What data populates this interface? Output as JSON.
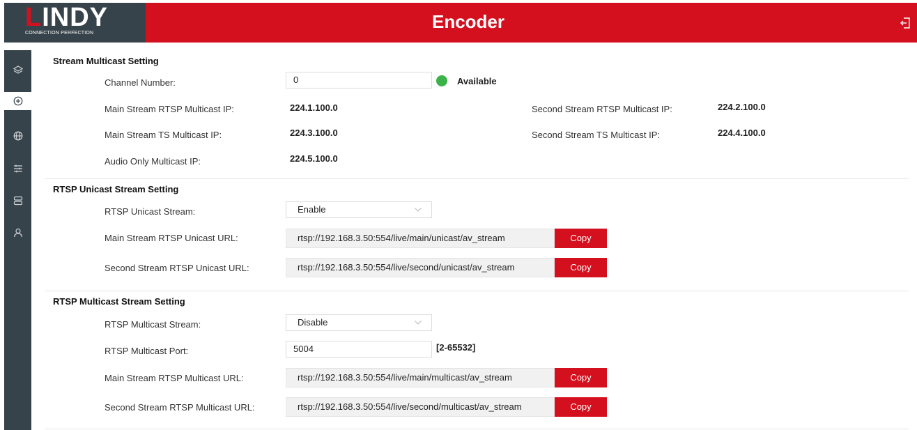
{
  "header": {
    "logo_text_rest": "INDY",
    "logo_subtitle": "CONNECTION PERFECTION",
    "title": "Encoder"
  },
  "sidebar": {
    "items": [
      {
        "icon": "layers-icon",
        "active": false
      },
      {
        "icon": "plus-circle-icon",
        "active": true
      },
      {
        "icon": "globe-icon",
        "active": false
      },
      {
        "icon": "sliders-icon",
        "active": false
      },
      {
        "icon": "server-icon",
        "active": false
      },
      {
        "icon": "user-icon",
        "active": false
      }
    ]
  },
  "stream_multicast": {
    "title": "Stream Multicast Setting",
    "channel_label": "Channel Number:",
    "channel_value": "0",
    "status_text": "Available",
    "status_color": "#3cb34a",
    "main_rtsp_label": "Main Stream RTSP Multicast IP:",
    "main_rtsp_value": "224.1.100.0",
    "second_rtsp_label": "Second Stream RTSP Multicast IP:",
    "second_rtsp_value": "224.2.100.0",
    "main_ts_label": "Main Stream TS Multicast IP:",
    "main_ts_value": "224.3.100.0",
    "second_ts_label": "Second Stream TS Multicast IP:",
    "second_ts_value": "224.4.100.0",
    "audio_label": "Audio Only Multicast IP:",
    "audio_value": "224.5.100.0"
  },
  "rtsp_unicast": {
    "title": "RTSP Unicast Stream Setting",
    "stream_label": "RTSP Unicast Stream:",
    "stream_value": "Enable",
    "main_url_label": "Main Stream RTSP Unicast URL:",
    "main_url_value": "rtsp://192.168.3.50:554/live/main/unicast/av_stream",
    "second_url_label": "Second Stream RTSP Unicast URL:",
    "second_url_value": "rtsp://192.168.3.50:554/live/second/unicast/av_stream",
    "copy_label": "Copy"
  },
  "rtsp_multicast": {
    "title": "RTSP Multicast Stream Setting",
    "stream_label": "RTSP Multicast Stream:",
    "stream_value": "Disable",
    "port_label": "RTSP Multicast Port:",
    "port_value": "5004",
    "port_range": "[2-65532]",
    "main_url_label": "Main Stream RTSP Multicast URL:",
    "main_url_value": "rtsp://192.168.3.50:554/live/main/multicast/av_stream",
    "second_url_label": "Second Stream RTSP Multicast URL:",
    "second_url_value": "rtsp://192.168.3.50:554/live/second/multicast/av_stream",
    "copy_label": "Copy"
  },
  "colors": {
    "brand_red": "#d5101e",
    "sidebar_dark": "#37434a"
  }
}
